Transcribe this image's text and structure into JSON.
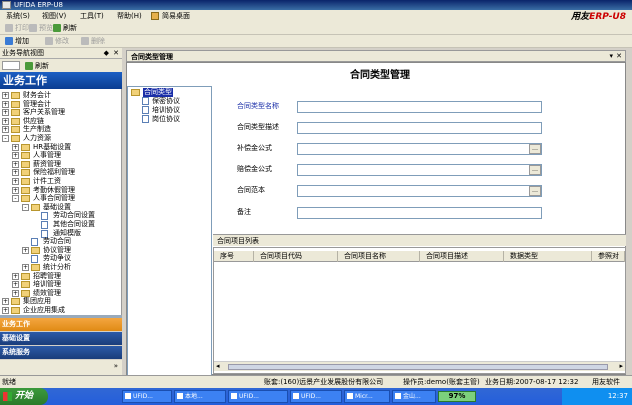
{
  "window": {
    "title": "UFIDA ERP-U8"
  },
  "brand": {
    "name": "用友",
    "suffix": "ERP-U8"
  },
  "menu": [
    "系统(S)",
    "视图(V)",
    "工具(T)",
    "帮助(H)",
    "简易桌面"
  ],
  "toolbar1": [
    "打印",
    "预览",
    "输出",
    "刷新"
  ],
  "toolbar2": [
    "增加",
    "修改",
    "删除"
  ],
  "nav": {
    "header": "业务导航视图",
    "refresh": "刷新",
    "banner": "业务工作",
    "tree": [
      {
        "label": "财务会计",
        "level": 0,
        "exp": "+",
        "icon": "folder"
      },
      {
        "label": "管理会计",
        "level": 0,
        "exp": "+",
        "icon": "folder"
      },
      {
        "label": "客户关系管理",
        "level": 0,
        "exp": "+",
        "icon": "folder"
      },
      {
        "label": "供应链",
        "level": 0,
        "exp": "+",
        "icon": "folder"
      },
      {
        "label": "生产制造",
        "level": 0,
        "exp": "+",
        "icon": "folder"
      },
      {
        "label": "人力资源",
        "level": 0,
        "exp": "-",
        "icon": "folder-open"
      },
      {
        "label": "HR基础设置",
        "level": 1,
        "exp": "+",
        "icon": "folder"
      },
      {
        "label": "人事管理",
        "level": 1,
        "exp": "+",
        "icon": "folder"
      },
      {
        "label": "薪资管理",
        "level": 1,
        "exp": "+",
        "icon": "folder"
      },
      {
        "label": "保险福利管理",
        "level": 1,
        "exp": "+",
        "icon": "folder"
      },
      {
        "label": "计件工资",
        "level": 1,
        "exp": "+",
        "icon": "folder"
      },
      {
        "label": "考勤休假管理",
        "level": 1,
        "exp": "+",
        "icon": "folder"
      },
      {
        "label": "人事合同管理",
        "level": 1,
        "exp": "-",
        "icon": "folder-open"
      },
      {
        "label": "基础设置",
        "level": 2,
        "exp": "-",
        "icon": "folder-open"
      },
      {
        "label": "劳动合同设置",
        "level": 3,
        "exp": "",
        "icon": "doc"
      },
      {
        "label": "其他合同设置",
        "level": 3,
        "exp": "",
        "icon": "doc"
      },
      {
        "label": "通知模版",
        "level": 3,
        "exp": "",
        "icon": "doc"
      },
      {
        "label": "劳动合同",
        "level": 2,
        "exp": "",
        "icon": "doc"
      },
      {
        "label": "协议管理",
        "level": 2,
        "exp": "+",
        "icon": "folder"
      },
      {
        "label": "劳动争议",
        "level": 2,
        "exp": "",
        "icon": "doc"
      },
      {
        "label": "统计分析",
        "level": 2,
        "exp": "+",
        "icon": "folder"
      },
      {
        "label": "招聘管理",
        "level": 1,
        "exp": "+",
        "icon": "folder"
      },
      {
        "label": "培训管理",
        "level": 1,
        "exp": "+",
        "icon": "folder"
      },
      {
        "label": "绩效管理",
        "level": 1,
        "exp": "+",
        "icon": "folder"
      },
      {
        "label": "集团应用",
        "level": 0,
        "exp": "+",
        "icon": "folder"
      },
      {
        "label": "企业应用集成",
        "level": 0,
        "exp": "+",
        "icon": "folder"
      }
    ],
    "buttons": [
      "业务工作",
      "基础设置",
      "系统服务"
    ]
  },
  "main": {
    "tab": "合同类型管理",
    "title": "合同类型管理",
    "contract_tree": {
      "root": "合同类型",
      "items": [
        "保密协议",
        "培训协议",
        "岗位协议"
      ]
    },
    "fields": [
      {
        "label": "合同类型名称",
        "value": "",
        "lookup": false,
        "highlight": true
      },
      {
        "label": "合同类型描述",
        "value": "",
        "lookup": false,
        "highlight": false
      },
      {
        "label": "补偿金公式",
        "value": "",
        "lookup": true,
        "highlight": false
      },
      {
        "label": "赔偿金公式",
        "value": "",
        "lookup": true,
        "highlight": false
      },
      {
        "label": "合同范本",
        "value": "",
        "lookup": true,
        "highlight": false
      },
      {
        "label": "备注",
        "value": "",
        "lookup": false,
        "highlight": false
      }
    ],
    "grid": {
      "title": "合同项目列表",
      "columns": [
        "序号",
        "合同项目代码",
        "合同项目名称",
        "合同项目描述",
        "数据类型",
        "参照对"
      ]
    }
  },
  "status": {
    "left": "就绪",
    "account": "账套:(160)远景产业发展股份有限公司",
    "operator": "操作员:demo(账套主管)",
    "date": "业务日期:2007-08-17 12:32",
    "product": "用友软件"
  },
  "taskbar": {
    "start": "开始",
    "tasks": [
      "UFID...",
      "本地...",
      "UFID...",
      "UFID...",
      "Micr...",
      "金山..."
    ],
    "battery": "97%",
    "time": "12:37"
  },
  "colors": {
    "highlight": "#1a2ea8",
    "banner": "#0b3d91",
    "accent_orange": "#e08a14"
  }
}
